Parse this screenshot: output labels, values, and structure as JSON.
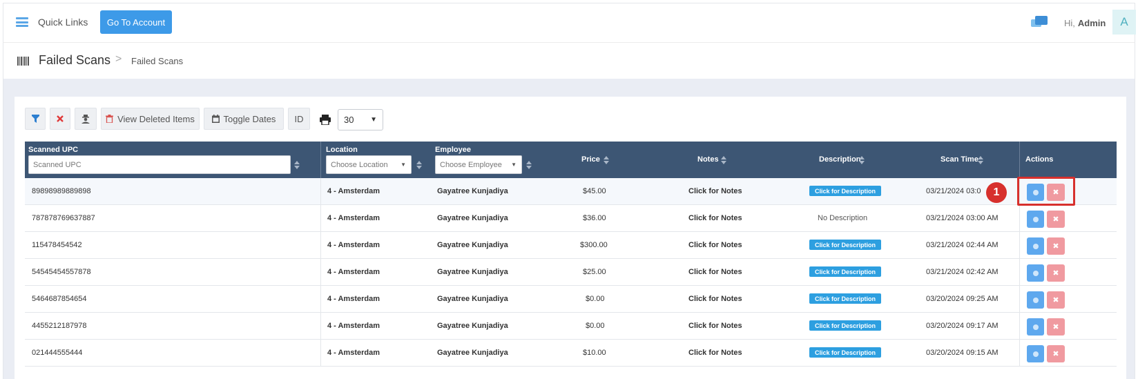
{
  "topbar": {
    "quick_links_label": "Quick Links",
    "goto_account_label": "Go To Account",
    "greeting": "Hi,",
    "user_name": "Admin",
    "avatar_letter": "A"
  },
  "breadcrumb": {
    "page_title": "Failed Scans",
    "separator": ">",
    "current": "Failed Scans"
  },
  "toolbar": {
    "view_deleted_label": "View Deleted Items",
    "toggle_dates_label": "Toggle Dates",
    "id_label": "ID",
    "per_page_value": "30"
  },
  "table": {
    "headers": {
      "scanned_upc": "Scanned UPC",
      "location": "Location",
      "employee": "Employee",
      "price": "Price",
      "notes": "Notes",
      "description": "Description",
      "scan_time": "Scan Time",
      "actions": "Actions"
    },
    "filters": {
      "upc_placeholder": "Scanned UPC",
      "location_placeholder": "Choose Location",
      "employee_placeholder": "Choose Employee"
    },
    "rows": [
      {
        "upc": "89898989889898",
        "location": "4 - Amsterdam",
        "employee": "Gayatree Kunjadiya",
        "price": "$45.00",
        "notes": "Click for Notes",
        "description": "Click for Description",
        "scan_time": "03/21/2024 03:0"
      },
      {
        "upc": "787878769637887",
        "location": "4 - Amsterdam",
        "employee": "Gayatree Kunjadiya",
        "price": "$36.00",
        "notes": "Click for Notes",
        "description": "No Description",
        "scan_time": "03/21/2024 03:00 AM"
      },
      {
        "upc": "115478454542",
        "location": "4 - Amsterdam",
        "employee": "Gayatree Kunjadiya",
        "price": "$300.00",
        "notes": "Click for Notes",
        "description": "Click for Description",
        "scan_time": "03/21/2024 02:44 AM"
      },
      {
        "upc": "54545454557878",
        "location": "4 - Amsterdam",
        "employee": "Gayatree Kunjadiya",
        "price": "$25.00",
        "notes": "Click for Notes",
        "description": "Click for Description",
        "scan_time": "03/21/2024 02:42 AM"
      },
      {
        "upc": "5464687854654",
        "location": "4 - Amsterdam",
        "employee": "Gayatree Kunjadiya",
        "price": "$0.00",
        "notes": "Click for Notes",
        "description": "Click for Description",
        "scan_time": "03/20/2024 09:25 AM"
      },
      {
        "upc": "4455212187978",
        "location": "4 - Amsterdam",
        "employee": "Gayatree Kunjadiya",
        "price": "$0.00",
        "notes": "Click for Notes",
        "description": "Click for Description",
        "scan_time": "03/20/2024 09:17 AM"
      },
      {
        "upc": "021444555444",
        "location": "4 - Amsterdam",
        "employee": "Gayatree Kunjadiya",
        "price": "$10.00",
        "notes": "Click for Notes",
        "description": "Click for Description",
        "scan_time": "03/20/2024 09:15 AM"
      }
    ]
  },
  "annotation": {
    "badge_number": "1"
  },
  "colors": {
    "primary": "#3d9ae8",
    "table_header": "#3d5674",
    "description_badge": "#2d9fe0",
    "delete_action": "#f09aa0",
    "view_action": "#5ea8ee",
    "annotation": "#d7302d"
  },
  "icons": {
    "quick_links": "hamburger-icon",
    "chat": "chat-icon",
    "page": "barcode-icon",
    "filter": "filter-icon",
    "clear": "close-icon",
    "user_secret": "user-secret-icon",
    "deleted": "trash-icon",
    "dates": "calendar-icon",
    "print": "print-icon",
    "sort": "sort-icon",
    "view": "circle-icon",
    "delete": "close-icon"
  }
}
